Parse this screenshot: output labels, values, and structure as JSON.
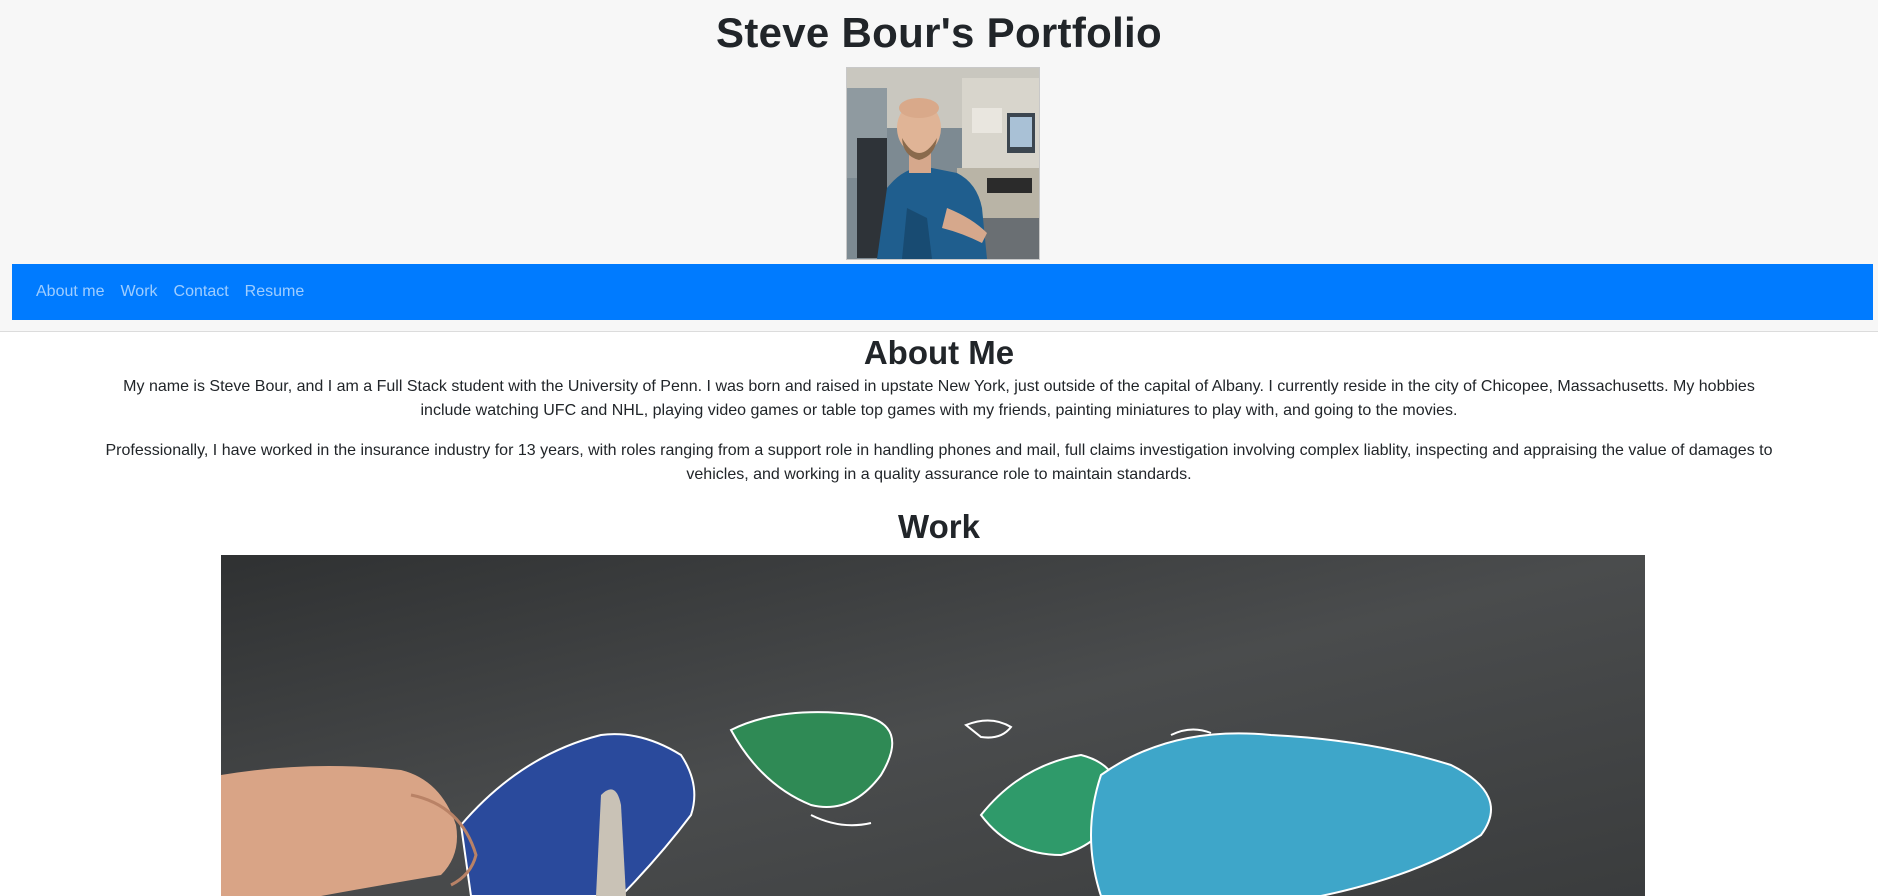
{
  "header": {
    "title": "Steve Bour's Portfolio"
  },
  "nav": {
    "items": [
      {
        "label": "About me"
      },
      {
        "label": "Work"
      },
      {
        "label": "Contact"
      },
      {
        "label": "Resume"
      }
    ]
  },
  "about": {
    "title": "About Me",
    "paragraph1": "My name is Steve Bour, and I am a Full Stack student with the University of Penn. I was born and raised in upstate New York, just outside of the capital of Albany. I currently reside in the city of Chicopee, Massachusetts. My hobbies include watching UFC and NHL, playing video games or table top games with my friends, painting miniatures to play with, and going to the movies.",
    "paragraph2": "Professionally, I have worked in the insurance industry for 13 years, with roles ranging from a support role in handling phones and mail, full claims investigation involving complex liablity, inspecting and appraising the value of damages to vehicles, and working in a quality assurance role to maintain standards."
  },
  "work": {
    "title": "Work"
  },
  "colors": {
    "navbar": "#007bff",
    "hero_background": "#f7f7f7",
    "text": "#212529"
  },
  "icons": {
    "profile_photo": "profile-photo",
    "work_image": "world-map-chalkboard-image"
  }
}
